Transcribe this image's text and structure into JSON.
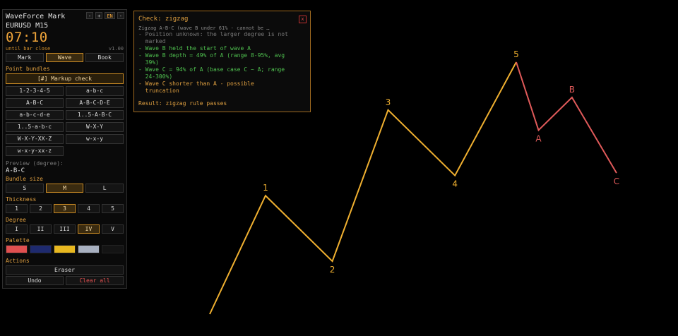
{
  "panel": {
    "title": "WaveForce Mark",
    "symbol": "EURUSD  M15",
    "timer": "07:10",
    "timer_sub": "until bar close",
    "version": "v1.00",
    "header_buttons": [
      "-",
      "+",
      "EN",
      "-"
    ],
    "tabs": [
      {
        "label": "Mark",
        "active": false
      },
      {
        "label": "Wave",
        "active": true
      },
      {
        "label": "Book",
        "active": false
      }
    ],
    "bundles_label": "Point bundles",
    "markup_check_label": "[#] Markup check",
    "bundles": [
      "1-2-3-4-5",
      "a-b-c",
      "A-B-C",
      "A-B-C-D-E",
      "a-b-c-d-e",
      "1..5-A-B-C",
      "1..5-a-b-c",
      "W-X-Y",
      "W-X-Y-XX-Z",
      "w-x-y",
      "w-x-y-xx-z"
    ],
    "preview_label": "Preview (degree):",
    "preview_value": "A-B-C",
    "bundle_size_label": "Bundle size",
    "bundle_sizes": [
      {
        "label": "S",
        "active": false
      },
      {
        "label": "M",
        "active": true
      },
      {
        "label": "L",
        "active": false
      }
    ],
    "thickness_label": "Thickness",
    "thickness": [
      {
        "label": "1",
        "active": false
      },
      {
        "label": "2",
        "active": false
      },
      {
        "label": "3",
        "active": true
      },
      {
        "label": "4",
        "active": false
      },
      {
        "label": "5",
        "active": false
      }
    ],
    "degree_label": "Degree",
    "degrees": [
      {
        "label": "I",
        "active": false
      },
      {
        "label": "II",
        "active": false
      },
      {
        "label": "III",
        "active": false
      },
      {
        "label": "IV",
        "active": true
      },
      {
        "label": "V",
        "active": false
      }
    ],
    "palette_label": "Palette",
    "palette": [
      "#e05050",
      "#1e2a6e",
      "#e8b820",
      "#a8b0c0",
      "#141414"
    ],
    "actions_label": "Actions",
    "eraser_label": "Eraser",
    "undo_label": "Undo",
    "clear_label": "Clear all"
  },
  "check": {
    "title": "Check: zigzag",
    "close": "x",
    "subtitle": "Zigzag A-B-C (wave B under 61% - cannot be …",
    "lines": [
      {
        "text": "- Position unknown: the larger degree is not\n  marked",
        "tone": "gray"
      },
      {
        "text": "- Wave B held the start of wave A",
        "tone": "green"
      },
      {
        "text": "- Wave B depth = 49% of A (range 8-95%, avg\n  39%)",
        "tone": "green"
      },
      {
        "text": "- Wave C = 94% of A (base case C ~ A; range\n  24-300%)",
        "tone": "green"
      },
      {
        "text": "- Wave C shorter than A - possible\n  truncation",
        "tone": "orange"
      }
    ],
    "result": "Result: zigzag rule passes"
  },
  "chart": {
    "impulse_color": "#f0b030",
    "correction_color": "#e05a5a",
    "impulse_points": [
      {
        "label": "",
        "x": 0.0,
        "y": 0.0
      },
      {
        "label": "1",
        "x": 1.0,
        "y": 4.7
      },
      {
        "label": "2",
        "x": 2.2,
        "y": 2.1
      },
      {
        "label": "3",
        "x": 3.2,
        "y": 8.1
      },
      {
        "label": "4",
        "x": 4.4,
        "y": 5.5
      },
      {
        "label": "5",
        "x": 5.5,
        "y": 10.0
      }
    ],
    "correction_points": [
      {
        "label": "A",
        "x": 5.9,
        "y": 7.3
      },
      {
        "label": "B",
        "x": 6.5,
        "y": 8.6
      },
      {
        "label": "C",
        "x": 7.3,
        "y": 5.6
      }
    ]
  }
}
